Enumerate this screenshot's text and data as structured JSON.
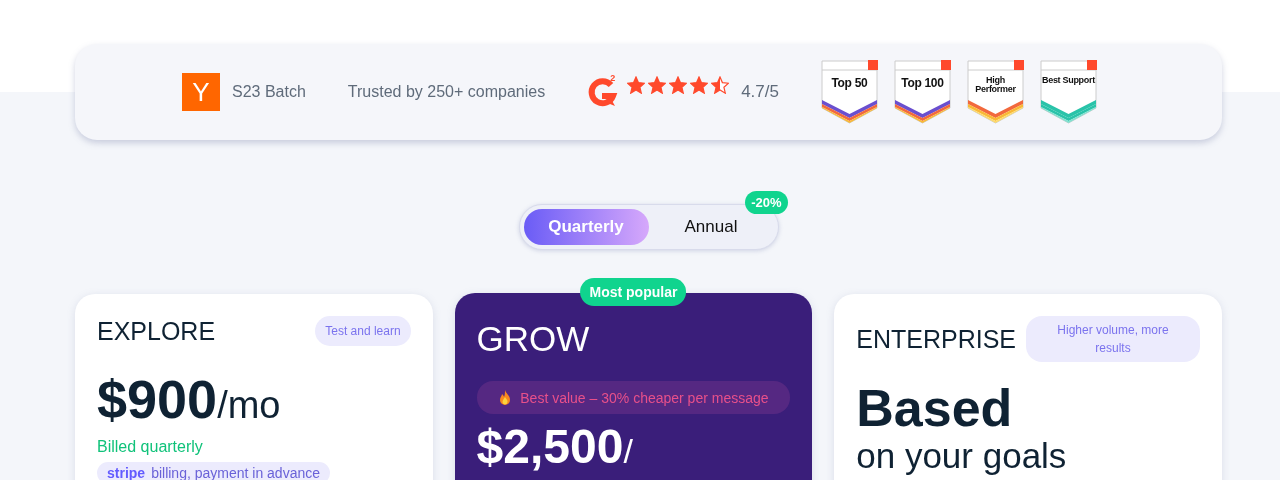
{
  "trust_bar": {
    "yc": {
      "logo": "Y",
      "label": "S23 Batch"
    },
    "trusted": "Trusted by 250+ companies",
    "g2": {
      "logo_mark": "2",
      "stars": 4.5,
      "rating": "4.7/5"
    },
    "badges": [
      {
        "kind": "ranked",
        "title": "Top 50"
      },
      {
        "kind": "ranked",
        "title": "Top 100"
      },
      {
        "kind": "performer",
        "title": "High Performer"
      },
      {
        "kind": "support",
        "title": "Best Support"
      }
    ]
  },
  "billing_toggle": {
    "options": [
      {
        "label": "Quarterly",
        "selected": true
      },
      {
        "label": "Annual",
        "selected": false
      }
    ],
    "discount": "-20%"
  },
  "plans": [
    {
      "kind": "standard",
      "name": "EXPLORE",
      "tag": "Test and learn",
      "price": "$900",
      "unit": "/mo",
      "billing_note": "Billed quarterly",
      "payment": {
        "brand": "stripe",
        "text": "billing, payment in advance"
      }
    },
    {
      "kind": "featured",
      "ribbon": "Most popular",
      "name": "GROW",
      "highlight": "Best value – 30% cheaper per message",
      "price": "$2,500",
      "unit": "/"
    },
    {
      "kind": "custom",
      "name": "ENTERPRISE",
      "tag": "Higher volume, more results",
      "headline": "Based",
      "subline": "on your goals"
    }
  ]
}
